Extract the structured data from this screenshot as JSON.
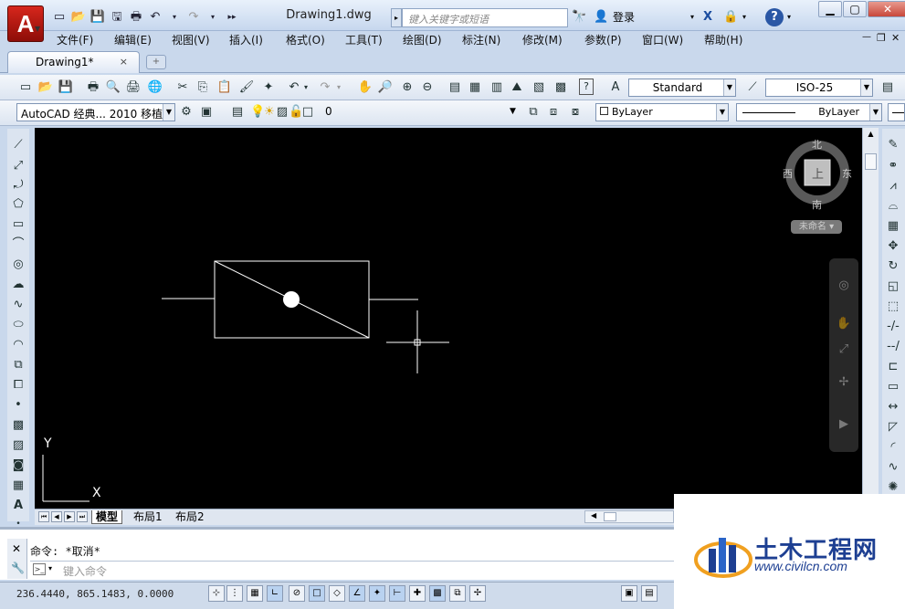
{
  "app": {
    "logo_letter": "A",
    "doc_title": "Drawing1.dwg",
    "search_placeholder": "键入关键字或短语",
    "login": "登录",
    "help": "?",
    "brand_color": "#c8201a"
  },
  "menu": {
    "items": [
      "文件(F)",
      "编辑(E)",
      "视图(V)",
      "插入(I)",
      "格式(O)",
      "工具(T)",
      "绘图(D)",
      "标注(N)",
      "修改(M)",
      "参数(P)",
      "窗口(W)",
      "帮助(H)"
    ]
  },
  "tabs": {
    "active": "Drawing1*",
    "close": "×"
  },
  "toolbar": {
    "text_style": "Standard",
    "dim_style": "ISO-25",
    "workspace": "AutoCAD 经典... 2010 移植",
    "layer": "0",
    "color": "ByLayer",
    "linetype": "ByLayer"
  },
  "viewcube": {
    "north": "北",
    "south": "南",
    "east": "东",
    "west": "西",
    "top": "上",
    "ucs_name": "未命名"
  },
  "ucs": {
    "x": "X",
    "y": "Y"
  },
  "layouts": {
    "items": [
      "模型",
      "布局1",
      "布局2"
    ]
  },
  "command": {
    "history": "命令:  *取消*",
    "placeholder": "键入命令"
  },
  "status": {
    "coords": "236.4440, 865.1483, 0.0000"
  },
  "watermark": {
    "title": "土木工程网",
    "url": "www.civilcn.com"
  }
}
